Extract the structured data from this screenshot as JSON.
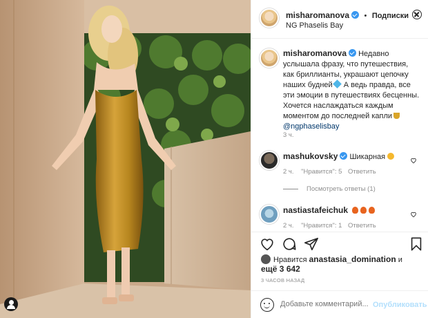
{
  "post": {
    "username": "misharomanova",
    "follow_label": "Подписки",
    "location": "NG Phaselis Bay",
    "caption_text": "Недавно услышала фразу, что путешествия, как бриллианты, украшают цепочку наших будней",
    "caption_text_2": "А ведь правда, все эти эмоции в путешествиях бесценны. Хочется наслаждаться каждым моментом до последней капли",
    "caption_mention": "@ngphaselisbay",
    "caption_time": "3 ч."
  },
  "comments": [
    {
      "username": "mashukovsky",
      "text": "Шикарная",
      "time": "2 ч.",
      "likes": "\"Нравится\": 5",
      "reply": "Ответить",
      "view_replies": "Посмотреть ответы (1)"
    },
    {
      "username": "nastiastafeichuk",
      "text": "",
      "time": "2 ч.",
      "likes": "\"Нравится\": 1",
      "reply": "Ответить"
    }
  ],
  "likes": {
    "prefix": "Нравится",
    "user": "anastasia_domination",
    "conj": "и",
    "line2": "ещё 3 642"
  },
  "timestamp": "3 ЧАСОВ НАЗАД",
  "comment_input": {
    "placeholder": "Добавьте комментарий...",
    "publish": "Опубликовать"
  },
  "icons": [
    "heart-icon",
    "comment-icon",
    "share-icon",
    "bookmark-icon",
    "more-icon",
    "smile-icon",
    "verified-icon"
  ]
}
